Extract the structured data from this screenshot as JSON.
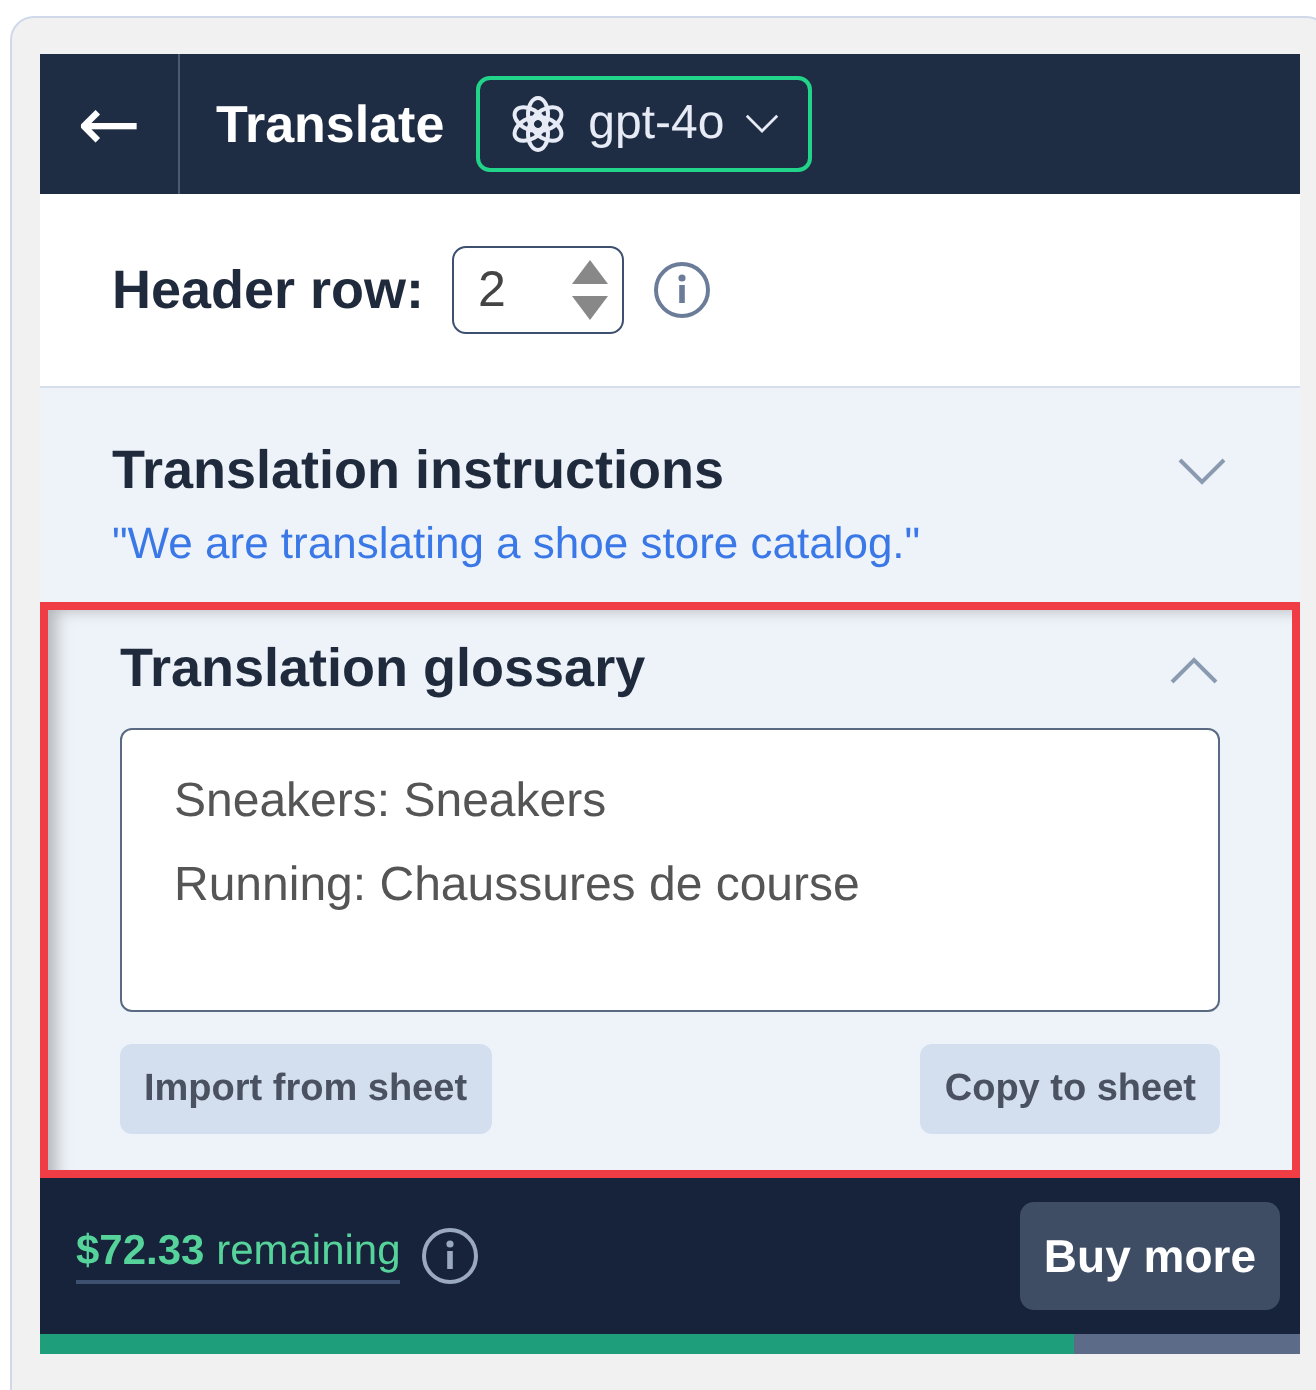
{
  "header": {
    "back_icon": "←",
    "title": "Translate",
    "model": "gpt-4o"
  },
  "header_row": {
    "label": "Header row:",
    "value": "2"
  },
  "sections": [
    {
      "kind": "instructions",
      "title": "Translation instructions",
      "expanded": false,
      "highlighted": false,
      "text": "\"We are translating a shoe store catalog.\""
    },
    {
      "kind": "glossary",
      "title": "Translation glossary",
      "expanded": true,
      "highlighted": true,
      "entries": [
        "Sneakers: Sneakers",
        "Running: Chaussures de course"
      ],
      "buttons": [
        "Import from sheet",
        "Copy to sheet"
      ]
    }
  ],
  "footer": {
    "amount": "$72.33",
    "remaining": "remaining",
    "button": "Buy more",
    "level": 0.82
  }
}
